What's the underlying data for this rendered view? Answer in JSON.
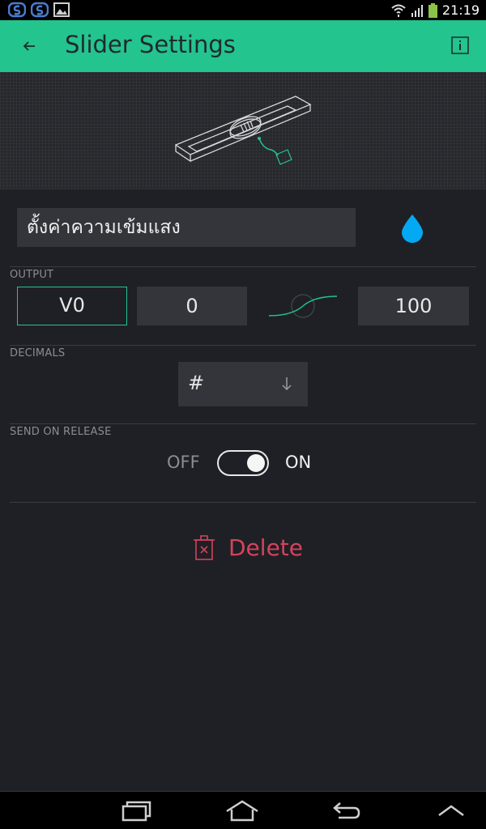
{
  "status_bar": {
    "time": "21:19"
  },
  "app_bar": {
    "title": "Slider Settings"
  },
  "widget": {
    "name": "ตั้งค่าความเข้มแสง",
    "color": "#04a9f4"
  },
  "output": {
    "label": "OUTPUT",
    "pin": "V0",
    "min": "0",
    "max": "100"
  },
  "decimals": {
    "label": "DECIMALS",
    "selected": "#"
  },
  "send_on_release": {
    "label": "SEND ON RELEASE",
    "off": "OFF",
    "on": "ON",
    "state": true
  },
  "delete": {
    "label": "Delete"
  },
  "colors": {
    "accent": "#23c48e",
    "danger": "#d3435c",
    "background": "#1f2025",
    "field": "#33353b"
  },
  "icons": [
    "back-arrow-icon",
    "info-icon",
    "water-drop-icon",
    "curve-icon",
    "down-arrow-icon",
    "trash-icon",
    "recent-apps-icon",
    "home-icon",
    "back-icon",
    "collapse-icon"
  ]
}
